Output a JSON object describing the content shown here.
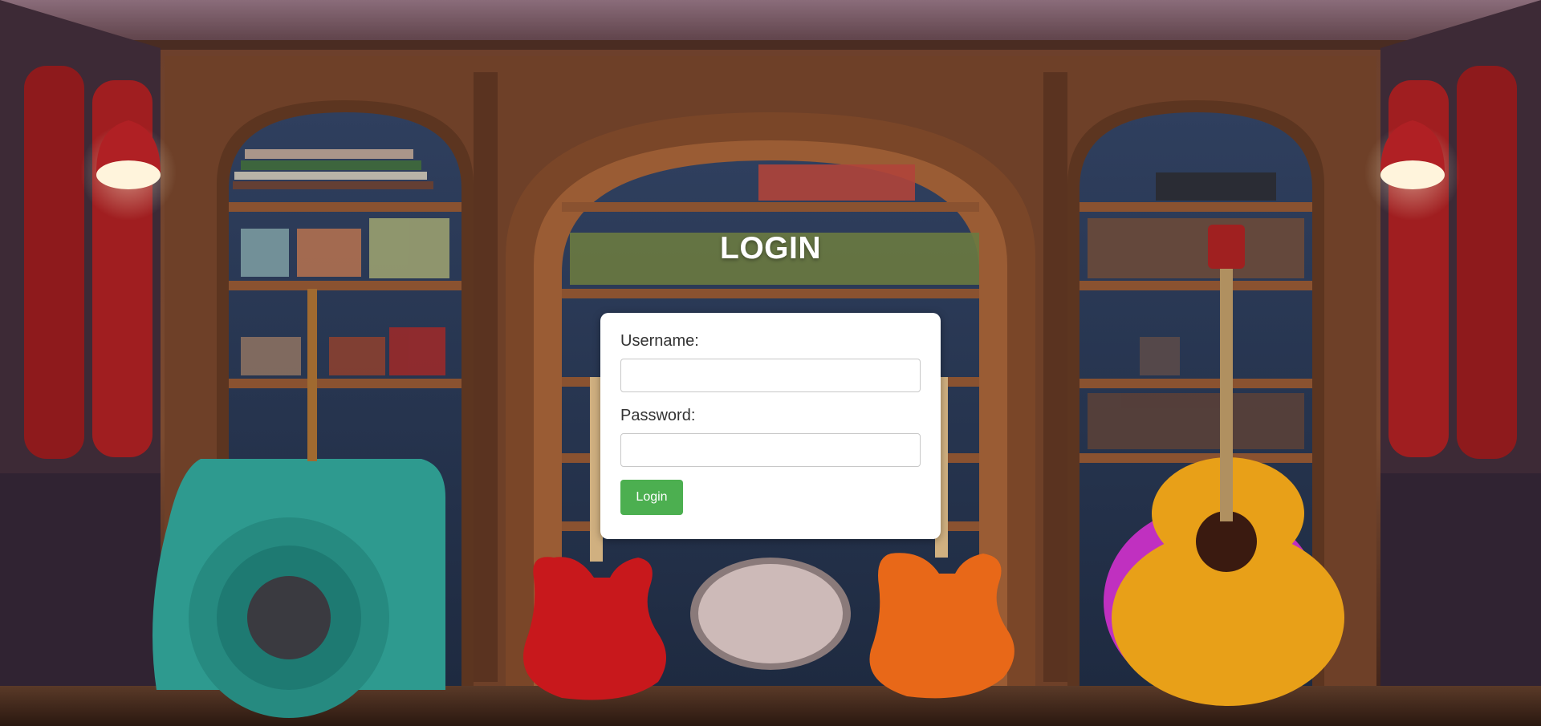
{
  "page": {
    "title": "LOGIN"
  },
  "form": {
    "username_label": "Username:",
    "username_value": "",
    "password_label": "Password:",
    "password_value": "",
    "submit_label": "Login"
  },
  "colors": {
    "button_bg": "#4caf50",
    "card_bg": "#ffffff",
    "title_text": "#ffffff"
  },
  "background": {
    "description_icon": "music-room-illustration"
  }
}
